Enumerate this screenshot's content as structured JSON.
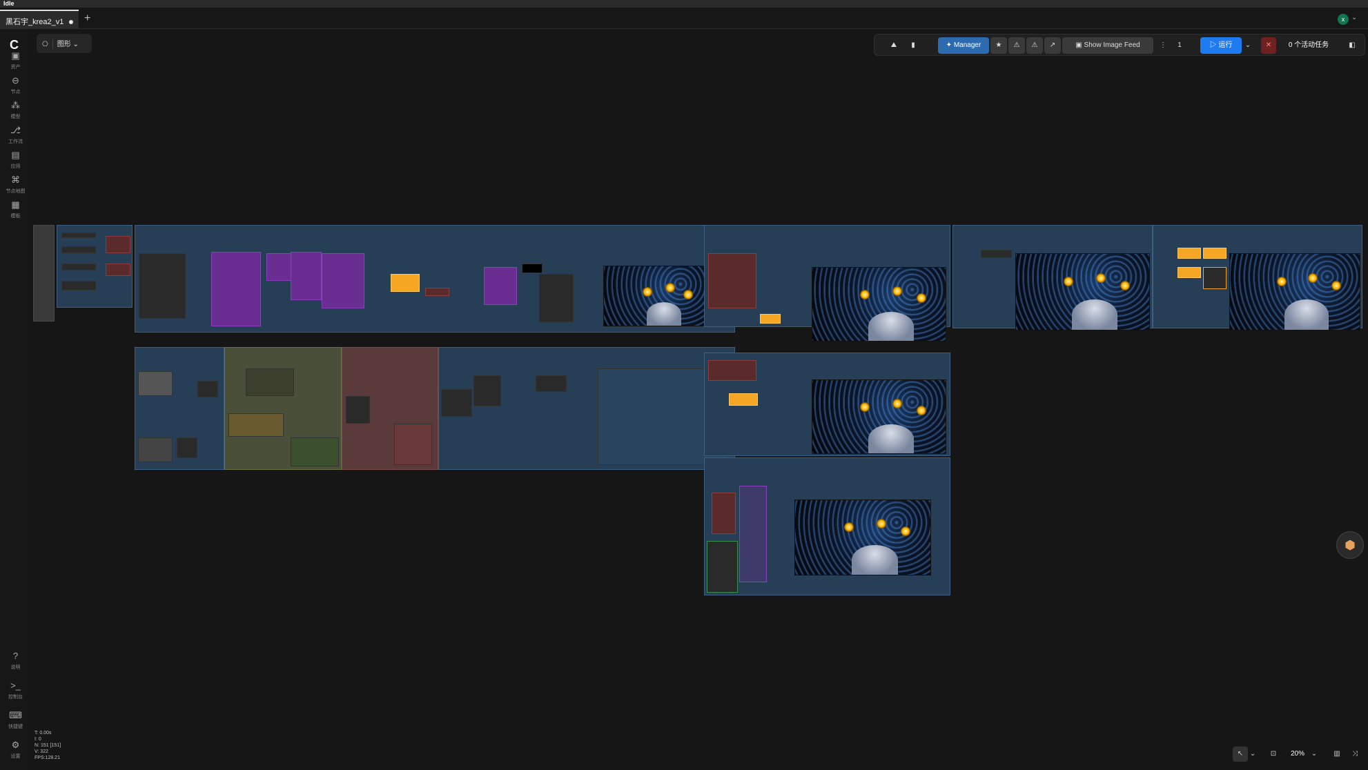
{
  "app": {
    "status": "Idle"
  },
  "tabs": [
    {
      "label": "黑石宇_krea2_v1",
      "modified": true
    }
  ],
  "tabbar": {
    "new_tab": "+",
    "user_initial": "x",
    "menu": "⌄"
  },
  "sidebar": {
    "items": [
      {
        "icon": "image-icon",
        "label": "资产"
      },
      {
        "icon": "node-icon",
        "label": "节点"
      },
      {
        "icon": "model-icon",
        "label": "模型"
      },
      {
        "icon": "workflow-icon",
        "label": "工作流"
      },
      {
        "icon": "template-icon",
        "label": "应用"
      },
      {
        "icon": "node-library-icon",
        "label": "节点地图"
      },
      {
        "icon": "layout-icon",
        "label": "模板"
      }
    ],
    "bottom": [
      {
        "icon": "help-icon",
        "label": "说明"
      },
      {
        "icon": "terminal-icon",
        "label": "控制台"
      },
      {
        "icon": "keyboard-icon",
        "label": "快捷键"
      },
      {
        "icon": "gear-icon",
        "label": "设置"
      }
    ]
  },
  "graph_mode": {
    "label": "图形"
  },
  "toolbar": {
    "manager": "Manager",
    "image_feed": "Show Image Feed",
    "queue_count": "1",
    "run": "运行",
    "active_tasks": "0 个活动任务"
  },
  "stats": {
    "t": "T: 0.00s",
    "i": "I: 0",
    "n": "N: 151 [151]",
    "v": "V: 322",
    "fps": "FPS:128.21"
  },
  "bottom_bar": {
    "zoom": "20%"
  },
  "colors": {
    "accent": "#1f7cf0",
    "group": "#263f57",
    "highlight": "#f5a623"
  }
}
